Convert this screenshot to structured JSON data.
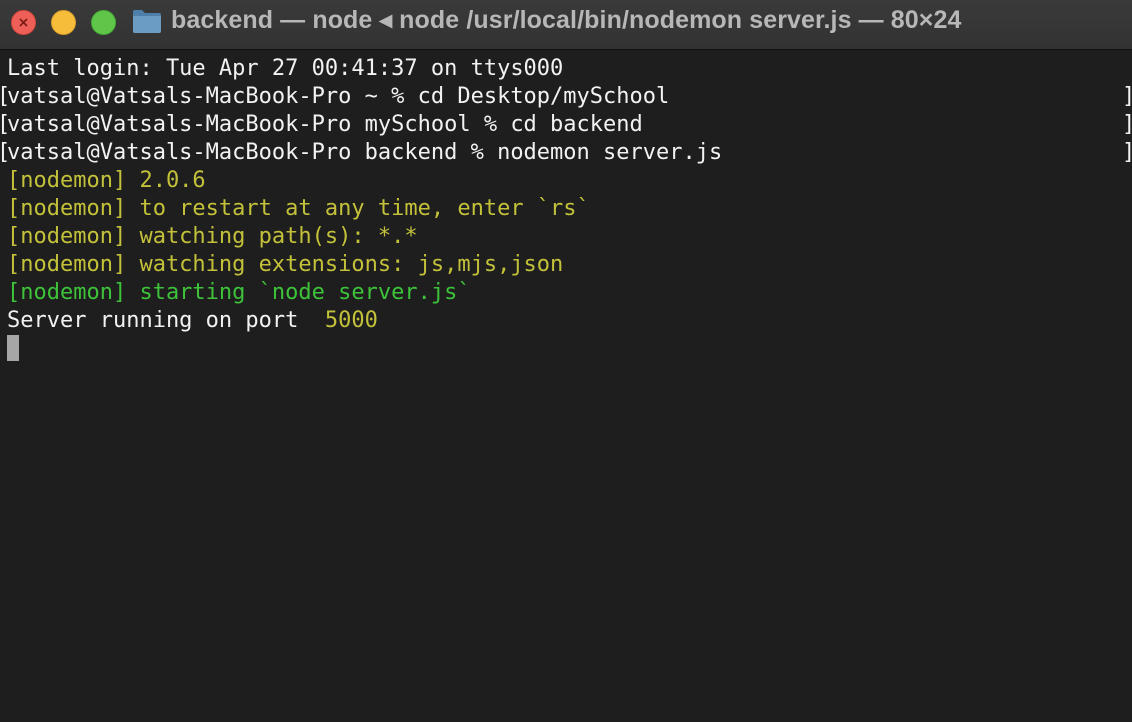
{
  "window": {
    "title": "backend — node ◂ node /usr/local/bin/nodemon server.js — 80×24"
  },
  "terminal": {
    "lines": [
      {
        "segments": [
          {
            "text": "Last login: Tue Apr 27 00:41:37 on ttys000",
            "color": "white"
          }
        ],
        "brackets": false
      },
      {
        "segments": [
          {
            "text": "vatsal@Vatsals-MacBook-Pro ~ % cd Desktop/mySchool",
            "color": "white"
          }
        ],
        "brackets": true
      },
      {
        "segments": [
          {
            "text": "vatsal@Vatsals-MacBook-Pro mySchool % cd backend",
            "color": "white"
          }
        ],
        "brackets": true
      },
      {
        "segments": [
          {
            "text": "vatsal@Vatsals-MacBook-Pro backend % nodemon server.js",
            "color": "white"
          }
        ],
        "brackets": true
      },
      {
        "segments": [
          {
            "text": "[nodemon] 2.0.6",
            "color": "yellow"
          }
        ],
        "brackets": false
      },
      {
        "segments": [
          {
            "text": "[nodemon] to restart at any time, enter `rs`",
            "color": "yellow"
          }
        ],
        "brackets": false
      },
      {
        "segments": [
          {
            "text": "[nodemon] watching path(s): *.*",
            "color": "yellow"
          }
        ],
        "brackets": false
      },
      {
        "segments": [
          {
            "text": "[nodemon] watching extensions: js,mjs,json",
            "color": "yellow"
          }
        ],
        "brackets": false
      },
      {
        "segments": [
          {
            "text": "[nodemon] starting `node server.js`",
            "color": "green"
          }
        ],
        "brackets": false
      },
      {
        "segments": [
          {
            "text": "Server running on port  ",
            "color": "white"
          },
          {
            "text": "5000",
            "color": "yellow"
          }
        ],
        "brackets": false
      }
    ]
  },
  "colors": {
    "background": "#1e1e1e",
    "text": "#f2f2f2",
    "nodemon_yellow": "#c3c13a",
    "nodemon_green": "#3dc23a",
    "close": "#ed5f57",
    "minimize": "#f5bd3a",
    "zoom": "#5fc649"
  },
  "icons": {
    "close": "close-icon",
    "minimize": "minimize-icon",
    "zoom": "zoom-icon",
    "folder": "folder-icon"
  }
}
